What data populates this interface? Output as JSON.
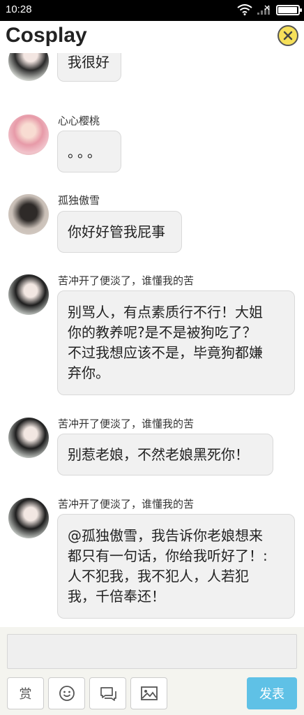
{
  "status_bar": {
    "time": "10:28"
  },
  "header": {
    "title": "Cosplay"
  },
  "messages": [
    {
      "name": "",
      "text": "我很好"
    },
    {
      "name": "心心樱桃",
      "text": "。。。"
    },
    {
      "name": "孤独傲雪",
      "text": "你好好管我屁事"
    },
    {
      "name": "苦冲开了便淡了，谁懂我的苦",
      "lines": [
        "别骂人，有点素质行不行！大姐",
        "你的教养呢?是不是被狗吃了？",
        "不过我想应该不是，毕竟狗都嫌",
        "弃你。"
      ]
    },
    {
      "name": "苦冲开了便淡了，谁懂我的苦",
      "text": "别惹老娘，不然老娘黑死你！"
    },
    {
      "name": "苦冲开了便淡了，谁懂我的苦",
      "lines": [
        "@孤独傲雪，我告诉你老娘想来",
        "都只有一句话，你给我听好了！:",
        "人不犯我，我不犯人，人若犯",
        "我，千倍奉还！"
      ]
    }
  ],
  "composer": {
    "input_value": "",
    "reward_label": "赏",
    "send_label": "发表"
  },
  "icons": [
    "wifi-icon",
    "signal-icon",
    "battery-icon",
    "close-icon",
    "emoji-icon",
    "comment-icon",
    "image-icon"
  ],
  "colors": {
    "accent": "#5fc1e6",
    "close_button": "#f6e05a",
    "bubble": "#f1f1f1"
  }
}
